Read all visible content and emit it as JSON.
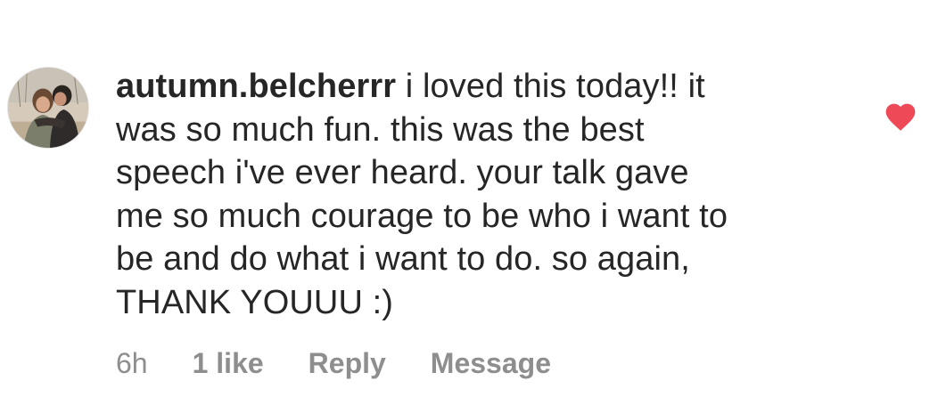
{
  "comment": {
    "username": "autumn.belcherrr",
    "text_lines": [
      " i loved this today!! it",
      "was so much fun. this was the best",
      "speech i've ever heard. your talk gave",
      "me so much courage to be who i want to",
      "be and do what i want to do. so again,",
      "THANK YOUUU :)"
    ],
    "liked": true,
    "heart_color": "#ed4956",
    "avatar_icon": "profile-photo",
    "heart_icon": "heart-filled-icon"
  },
  "meta": {
    "time": "6h",
    "likes": "1 like",
    "reply_label": "Reply",
    "message_label": "Message"
  },
  "colors": {
    "text": "#262626",
    "secondary": "#8e8e8e"
  }
}
